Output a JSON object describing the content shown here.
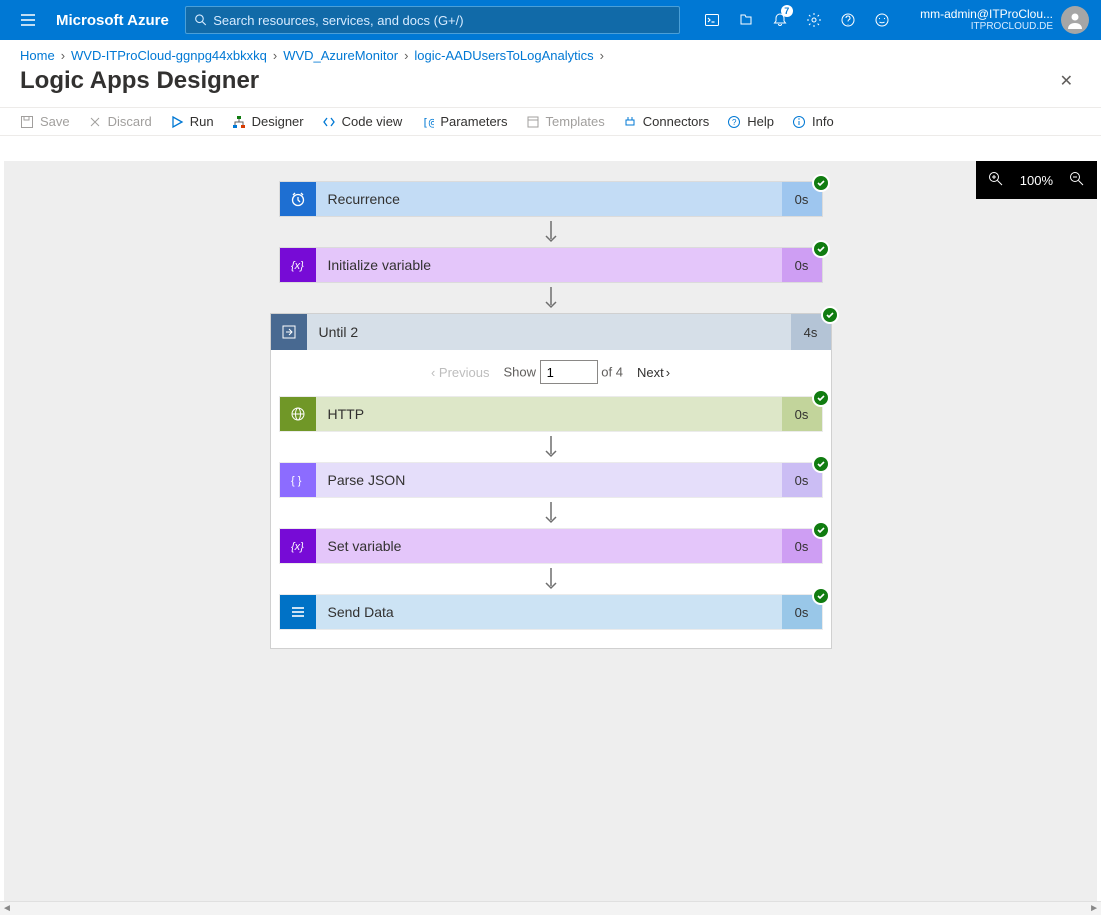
{
  "header": {
    "brand": "Microsoft Azure",
    "search_placeholder": "Search resources, services, and docs (G+/)",
    "notification_count": "7",
    "user_name": "mm-admin@ITProClou...",
    "user_domain": "ITPROCLOUD.DE"
  },
  "breadcrumb": [
    "Home",
    "WVD-ITProCloud-ggnpg44xbkxkq",
    "WVD_AzureMonitor",
    "logic-AADUsersToLogAnalytics"
  ],
  "title": "Logic Apps Designer",
  "toolbar": {
    "save": "Save",
    "discard": "Discard",
    "run": "Run",
    "designer": "Designer",
    "codeview": "Code view",
    "parameters": "Parameters",
    "templates": "Templates",
    "connectors": "Connectors",
    "help": "Help",
    "info": "Info"
  },
  "zoom": "100%",
  "nodes": {
    "recurrence": {
      "label": "Recurrence",
      "time": "0s"
    },
    "init_var": {
      "label": "Initialize variable",
      "time": "0s"
    },
    "until": {
      "label": "Until 2",
      "time": "4s"
    },
    "http": {
      "label": "HTTP",
      "time": "0s"
    },
    "parse": {
      "label": "Parse JSON",
      "time": "0s"
    },
    "set_var": {
      "label": "Set variable",
      "time": "0s"
    },
    "send": {
      "label": "Send Data",
      "time": "0s"
    }
  },
  "pager": {
    "previous": "Previous",
    "show": "Show",
    "value": "1",
    "of": "of 4",
    "next": "Next"
  }
}
